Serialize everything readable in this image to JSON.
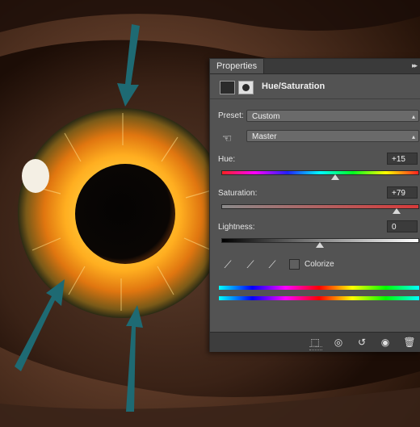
{
  "panel": {
    "tab_label": "Properties",
    "collapse_glyph": "▸▸",
    "title": "Hue/Saturation",
    "preset_label": "Preset:",
    "preset_value": "Custom",
    "channel_value": "Master",
    "hue_label": "Hue:",
    "hue_value": "+15",
    "hue_level": 0.58,
    "saturation_label": "Saturation:",
    "saturation_value": "+79",
    "saturation_level": 0.895,
    "lightness_label": "Lightness:",
    "lightness_value": "0",
    "lightness_level": 0.5,
    "colorize_label": "Colorize",
    "colorize_checked": false
  },
  "icons": {
    "adjustment": "hue-saturation-adjustment-icon",
    "mask": "layer-mask-icon",
    "hand": "targeted-adjustment-hand-icon",
    "eyedropper": "eyedropper-icon",
    "eyedropper_add": "eyedropper-add-icon",
    "eyedropper_subtract": "eyedropper-subtract-icon",
    "clip": "clip-to-layer-icon",
    "view_previous": "view-previous-state-icon",
    "reset": "reset-icon",
    "visibility": "eye-icon",
    "delete": "trash-icon"
  },
  "colors": {
    "panel_bg": "#535353",
    "arrow_teal": "#1e6a73",
    "saturation_red": "#d83a3a"
  }
}
